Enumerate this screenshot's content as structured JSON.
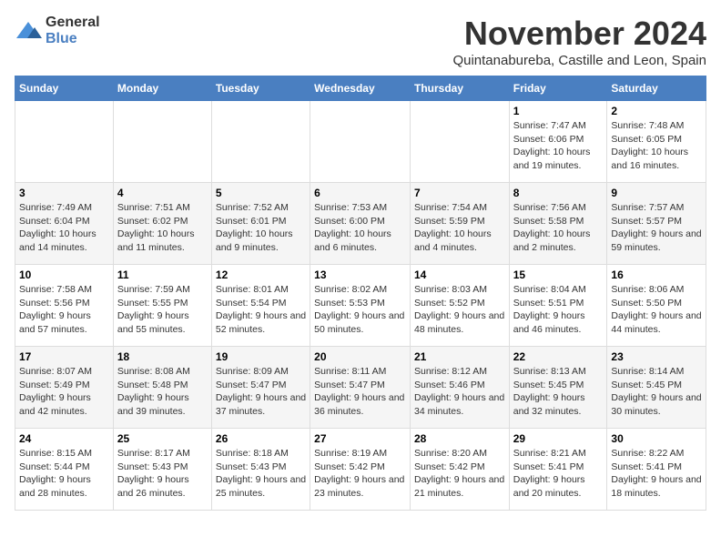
{
  "logo": {
    "general": "General",
    "blue": "Blue"
  },
  "title": "November 2024",
  "subtitle": "Quintanabureba, Castille and Leon, Spain",
  "headers": [
    "Sunday",
    "Monday",
    "Tuesday",
    "Wednesday",
    "Thursday",
    "Friday",
    "Saturday"
  ],
  "weeks": [
    [
      {
        "day": "",
        "info": ""
      },
      {
        "day": "",
        "info": ""
      },
      {
        "day": "",
        "info": ""
      },
      {
        "day": "",
        "info": ""
      },
      {
        "day": "",
        "info": ""
      },
      {
        "day": "1",
        "info": "Sunrise: 7:47 AM\nSunset: 6:06 PM\nDaylight: 10 hours and 19 minutes."
      },
      {
        "day": "2",
        "info": "Sunrise: 7:48 AM\nSunset: 6:05 PM\nDaylight: 10 hours and 16 minutes."
      }
    ],
    [
      {
        "day": "3",
        "info": "Sunrise: 7:49 AM\nSunset: 6:04 PM\nDaylight: 10 hours and 14 minutes."
      },
      {
        "day": "4",
        "info": "Sunrise: 7:51 AM\nSunset: 6:02 PM\nDaylight: 10 hours and 11 minutes."
      },
      {
        "day": "5",
        "info": "Sunrise: 7:52 AM\nSunset: 6:01 PM\nDaylight: 10 hours and 9 minutes."
      },
      {
        "day": "6",
        "info": "Sunrise: 7:53 AM\nSunset: 6:00 PM\nDaylight: 10 hours and 6 minutes."
      },
      {
        "day": "7",
        "info": "Sunrise: 7:54 AM\nSunset: 5:59 PM\nDaylight: 10 hours and 4 minutes."
      },
      {
        "day": "8",
        "info": "Sunrise: 7:56 AM\nSunset: 5:58 PM\nDaylight: 10 hours and 2 minutes."
      },
      {
        "day": "9",
        "info": "Sunrise: 7:57 AM\nSunset: 5:57 PM\nDaylight: 9 hours and 59 minutes."
      }
    ],
    [
      {
        "day": "10",
        "info": "Sunrise: 7:58 AM\nSunset: 5:56 PM\nDaylight: 9 hours and 57 minutes."
      },
      {
        "day": "11",
        "info": "Sunrise: 7:59 AM\nSunset: 5:55 PM\nDaylight: 9 hours and 55 minutes."
      },
      {
        "day": "12",
        "info": "Sunrise: 8:01 AM\nSunset: 5:54 PM\nDaylight: 9 hours and 52 minutes."
      },
      {
        "day": "13",
        "info": "Sunrise: 8:02 AM\nSunset: 5:53 PM\nDaylight: 9 hours and 50 minutes."
      },
      {
        "day": "14",
        "info": "Sunrise: 8:03 AM\nSunset: 5:52 PM\nDaylight: 9 hours and 48 minutes."
      },
      {
        "day": "15",
        "info": "Sunrise: 8:04 AM\nSunset: 5:51 PM\nDaylight: 9 hours and 46 minutes."
      },
      {
        "day": "16",
        "info": "Sunrise: 8:06 AM\nSunset: 5:50 PM\nDaylight: 9 hours and 44 minutes."
      }
    ],
    [
      {
        "day": "17",
        "info": "Sunrise: 8:07 AM\nSunset: 5:49 PM\nDaylight: 9 hours and 42 minutes."
      },
      {
        "day": "18",
        "info": "Sunrise: 8:08 AM\nSunset: 5:48 PM\nDaylight: 9 hours and 39 minutes."
      },
      {
        "day": "19",
        "info": "Sunrise: 8:09 AM\nSunset: 5:47 PM\nDaylight: 9 hours and 37 minutes."
      },
      {
        "day": "20",
        "info": "Sunrise: 8:11 AM\nSunset: 5:47 PM\nDaylight: 9 hours and 36 minutes."
      },
      {
        "day": "21",
        "info": "Sunrise: 8:12 AM\nSunset: 5:46 PM\nDaylight: 9 hours and 34 minutes."
      },
      {
        "day": "22",
        "info": "Sunrise: 8:13 AM\nSunset: 5:45 PM\nDaylight: 9 hours and 32 minutes."
      },
      {
        "day": "23",
        "info": "Sunrise: 8:14 AM\nSunset: 5:45 PM\nDaylight: 9 hours and 30 minutes."
      }
    ],
    [
      {
        "day": "24",
        "info": "Sunrise: 8:15 AM\nSunset: 5:44 PM\nDaylight: 9 hours and 28 minutes."
      },
      {
        "day": "25",
        "info": "Sunrise: 8:17 AM\nSunset: 5:43 PM\nDaylight: 9 hours and 26 minutes."
      },
      {
        "day": "26",
        "info": "Sunrise: 8:18 AM\nSunset: 5:43 PM\nDaylight: 9 hours and 25 minutes."
      },
      {
        "day": "27",
        "info": "Sunrise: 8:19 AM\nSunset: 5:42 PM\nDaylight: 9 hours and 23 minutes."
      },
      {
        "day": "28",
        "info": "Sunrise: 8:20 AM\nSunset: 5:42 PM\nDaylight: 9 hours and 21 minutes."
      },
      {
        "day": "29",
        "info": "Sunrise: 8:21 AM\nSunset: 5:41 PM\nDaylight: 9 hours and 20 minutes."
      },
      {
        "day": "30",
        "info": "Sunrise: 8:22 AM\nSunset: 5:41 PM\nDaylight: 9 hours and 18 minutes."
      }
    ]
  ]
}
